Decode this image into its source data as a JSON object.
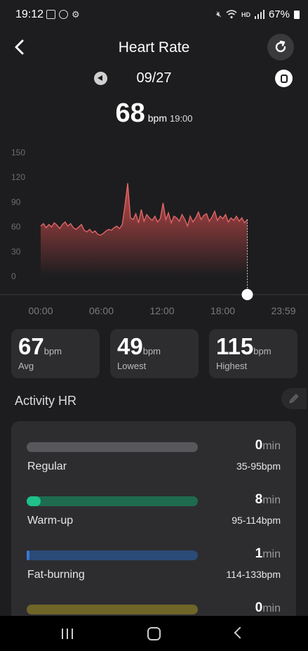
{
  "status_bar": {
    "time": "19:12",
    "network": "HD",
    "battery": "67%"
  },
  "header": {
    "title": "Heart Rate"
  },
  "date_nav": {
    "date": "09/27"
  },
  "current_reading": {
    "value": "68",
    "unit": "bpm",
    "time": "19:00"
  },
  "chart_data": {
    "type": "area",
    "title": "",
    "xlabel": "",
    "ylabel": "",
    "y_ticks": [
      "150",
      "120",
      "90",
      "60",
      "30",
      "0"
    ],
    "x_ticks": [
      "00:00",
      "06:00",
      "12:00",
      "18:00",
      "23:59"
    ],
    "ylim": [
      0,
      150
    ],
    "xlim": [
      0,
      24
    ],
    "grid": false,
    "colors": {
      "line": "#e06666",
      "fill_top": "#c64a4a",
      "fill_bottom": "#1d1d1f"
    },
    "x": [
      0,
      0.25,
      0.5,
      0.75,
      1,
      1.25,
      1.5,
      1.75,
      2,
      2.25,
      2.5,
      2.75,
      3,
      3.25,
      3.5,
      3.75,
      4,
      4.25,
      4.5,
      4.75,
      5,
      5.25,
      5.5,
      5.75,
      6,
      6.25,
      6.5,
      6.75,
      7,
      7.25,
      7.5,
      7.75,
      8,
      8.25,
      8.5,
      8.75,
      9,
      9.25,
      9.5,
      9.75,
      10,
      10.25,
      10.5,
      10.75,
      11,
      11.25,
      11.5,
      11.75,
      12,
      12.25,
      12.5,
      12.75,
      13,
      13.25,
      13.5,
      13.75,
      14,
      14.25,
      14.5,
      14.75,
      15,
      15.25,
      15.5,
      15.75,
      16,
      16.25,
      16.5,
      16.75,
      17,
      17.25,
      17.5,
      17.75,
      18,
      18.25,
      18.5,
      18.75,
      19
    ],
    "y": [
      60,
      63,
      58,
      62,
      59,
      64,
      61,
      57,
      62,
      65,
      60,
      63,
      58,
      56,
      59,
      62,
      55,
      53,
      56,
      52,
      54,
      50,
      49,
      51,
      54,
      56,
      55,
      58,
      60,
      57,
      62,
      85,
      112,
      70,
      68,
      75,
      64,
      80,
      66,
      74,
      70,
      67,
      72,
      65,
      69,
      88,
      68,
      76,
      64,
      72,
      70,
      66,
      74,
      68,
      60,
      72,
      65,
      70,
      77,
      68,
      73,
      75,
      66,
      71,
      78,
      67,
      72,
      69,
      74,
      65,
      70,
      67,
      72,
      66,
      70,
      64,
      68
    ],
    "x_range_note": "",
    "selected": {
      "x": 19,
      "y": 68
    }
  },
  "stats": [
    {
      "value": "67",
      "unit": "bpm",
      "label": "Avg"
    },
    {
      "value": "49",
      "unit": "bpm",
      "label": "Lowest"
    },
    {
      "value": "115",
      "unit": "bpm",
      "label": "Highest"
    }
  ],
  "activity": {
    "title": "Activity HR",
    "zones": [
      {
        "label": "Regular",
        "minutes": "0",
        "min_unit": "min",
        "range": "35-95bpm",
        "color": "#58585c",
        "fill_fraction": 0
      },
      {
        "label": "Warm-up",
        "minutes": "8",
        "min_unit": "min",
        "range": "95-114bpm",
        "color": "#1f6b4f",
        "accent": "#1fc08a",
        "fill_fraction": 0.08
      },
      {
        "label": "Fat-burning",
        "minutes": "1",
        "min_unit": "min",
        "range": "114-133bpm",
        "color": "#2a4a78",
        "accent": "#3a78d0",
        "fill_fraction": 0.01
      },
      {
        "label": "",
        "minutes": "0",
        "min_unit": "min",
        "range": "",
        "color": "#6f6528",
        "fill_fraction": 0
      }
    ]
  }
}
